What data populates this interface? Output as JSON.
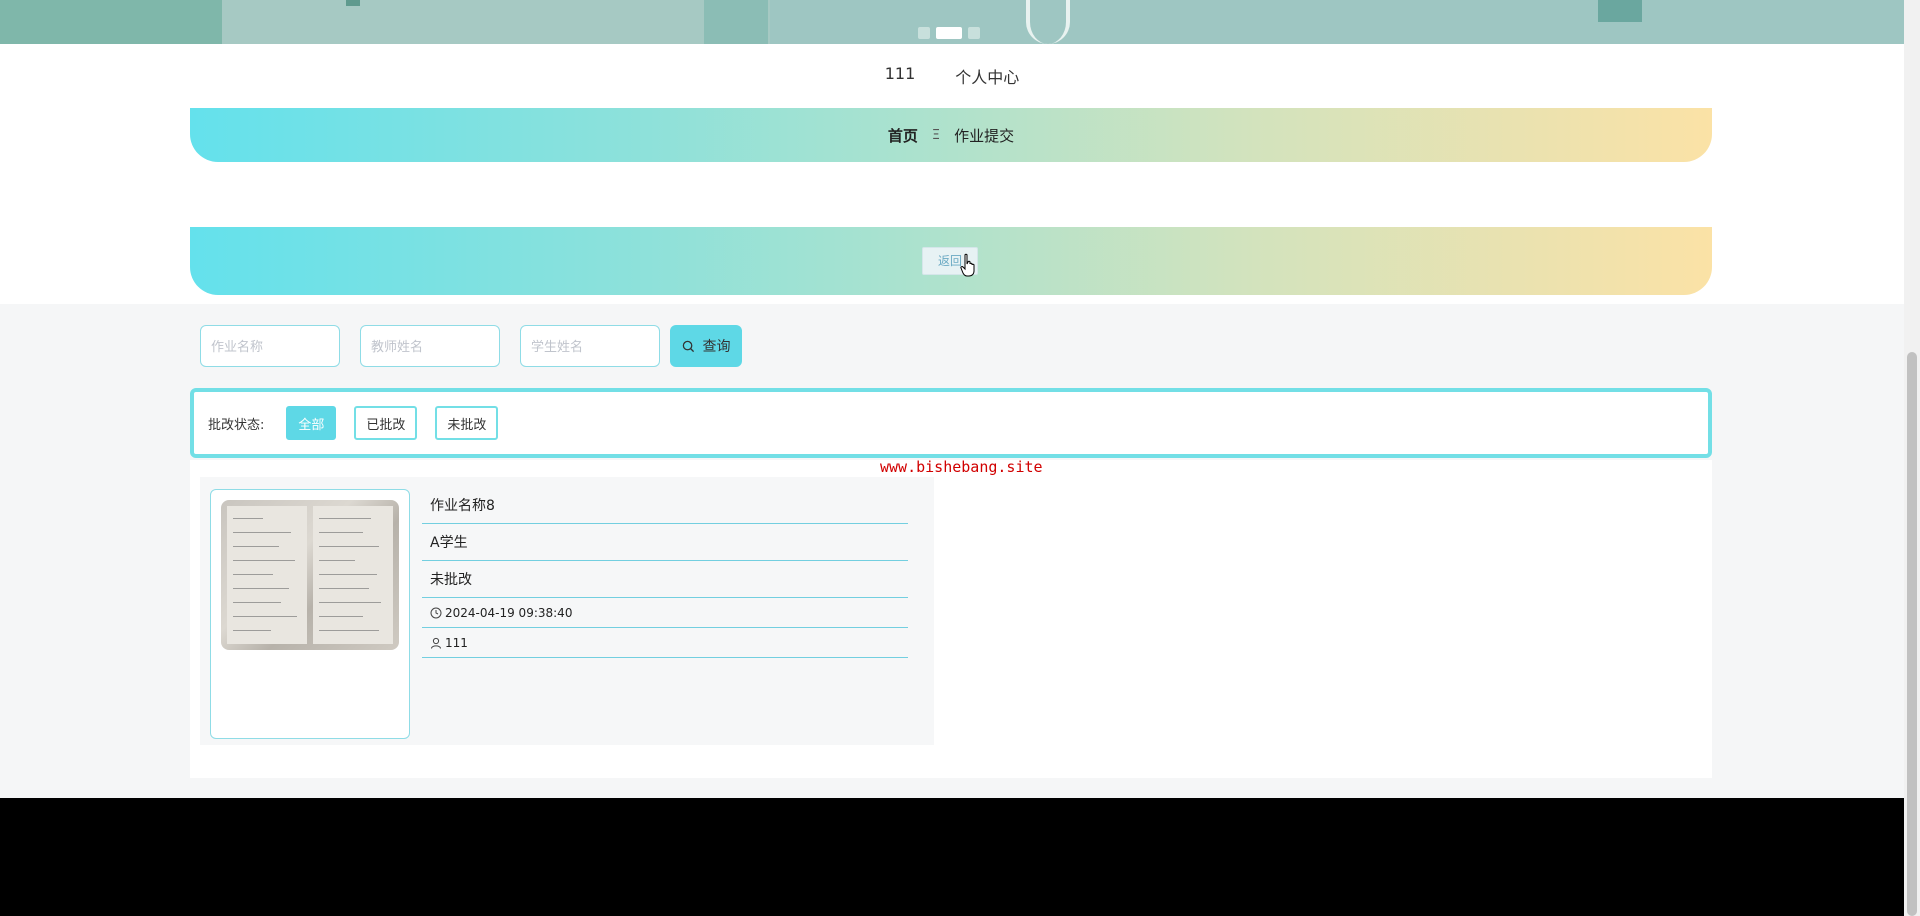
{
  "banner": {
    "dots": [
      {
        "active": false
      },
      {
        "active": true
      },
      {
        "active": false
      }
    ]
  },
  "user_nav": {
    "username": "111",
    "profile_label": "个人中心"
  },
  "nav": {
    "home_label": "首页",
    "separator": "Ξ",
    "current_label": "作业提交"
  },
  "breadcrumb": {
    "back_label": "返回"
  },
  "search": {
    "homework_name_placeholder": "作业名称",
    "teacher_name_placeholder": "教师姓名",
    "student_name_placeholder": "学生姓名",
    "button_label": "查询"
  },
  "filter": {
    "label": "批改状态:",
    "options": [
      "全部",
      "已批改",
      "未批改"
    ],
    "selected": "全部"
  },
  "watermark": "www.bishebang.site",
  "items": [
    {
      "homework_name": "作业名称8",
      "student_name": "A学生",
      "status": "未批改",
      "datetime": "2024-04-19 09:38:40",
      "user": "111"
    }
  ],
  "colors": {
    "accent": "#5ed8e6",
    "border": "#73dfe6",
    "gradient_start": "#64e1ec",
    "gradient_end": "#fbe2a6",
    "watermark": "#d10000",
    "footer": "#000000"
  }
}
